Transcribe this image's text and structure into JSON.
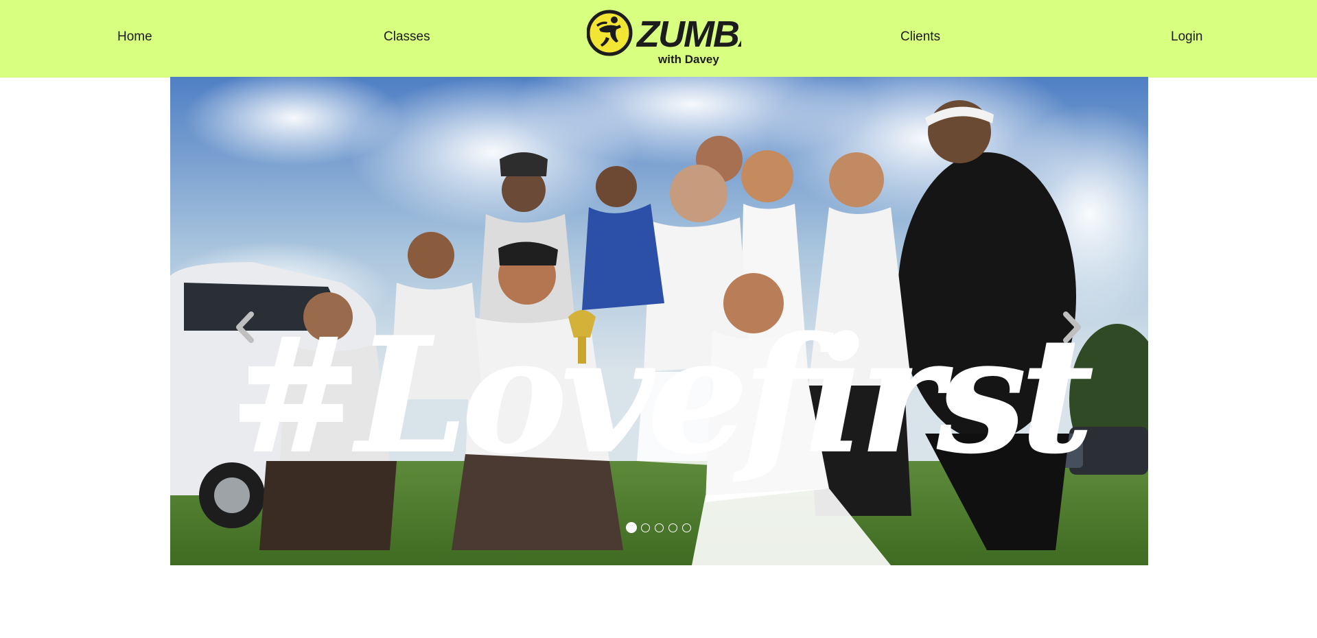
{
  "nav": {
    "home_label": "Home",
    "classes_label": "Classes",
    "clients_label": "Clients",
    "login_label": "Login"
  },
  "logo": {
    "brand": "ZUMBA",
    "tagline": "with Davey",
    "icon": "zumba-dancer-logo"
  },
  "carousel": {
    "caption": "#Lovefirst",
    "slide_count": 5,
    "active_index": 0,
    "prev_icon": "chevron-left-icon",
    "next_icon": "chevron-right-icon"
  },
  "colors": {
    "navbar_bg": "#d9ff80",
    "logo_yellow": "#f2e533",
    "logo_dark": "#1c1c1c",
    "nav_text": "#1a1a1a"
  }
}
